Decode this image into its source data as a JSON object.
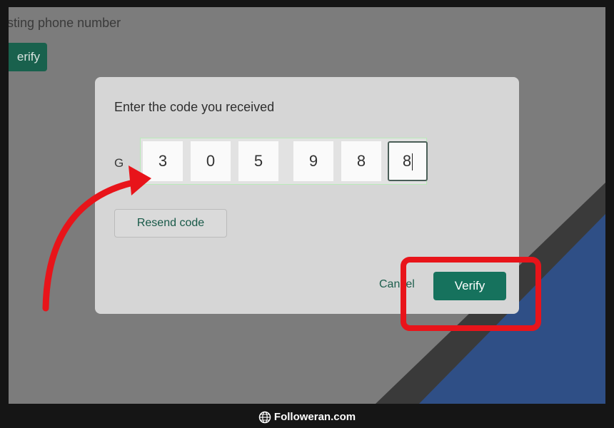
{
  "background": {
    "partial_text": "sting phone number",
    "partial_verify_label": "erify"
  },
  "dialog": {
    "title": "Enter the code you received",
    "prefix": "G",
    "digits": [
      "3",
      "0",
      "5",
      "9",
      "8",
      "8"
    ],
    "resend_label": "Resend code",
    "cancel_label": "Cancel",
    "verify_label": "Verify"
  },
  "footer": {
    "site": "Followeran.com"
  },
  "colors": {
    "primary_green": "#16725d",
    "annotation_red": "#e8141a"
  }
}
